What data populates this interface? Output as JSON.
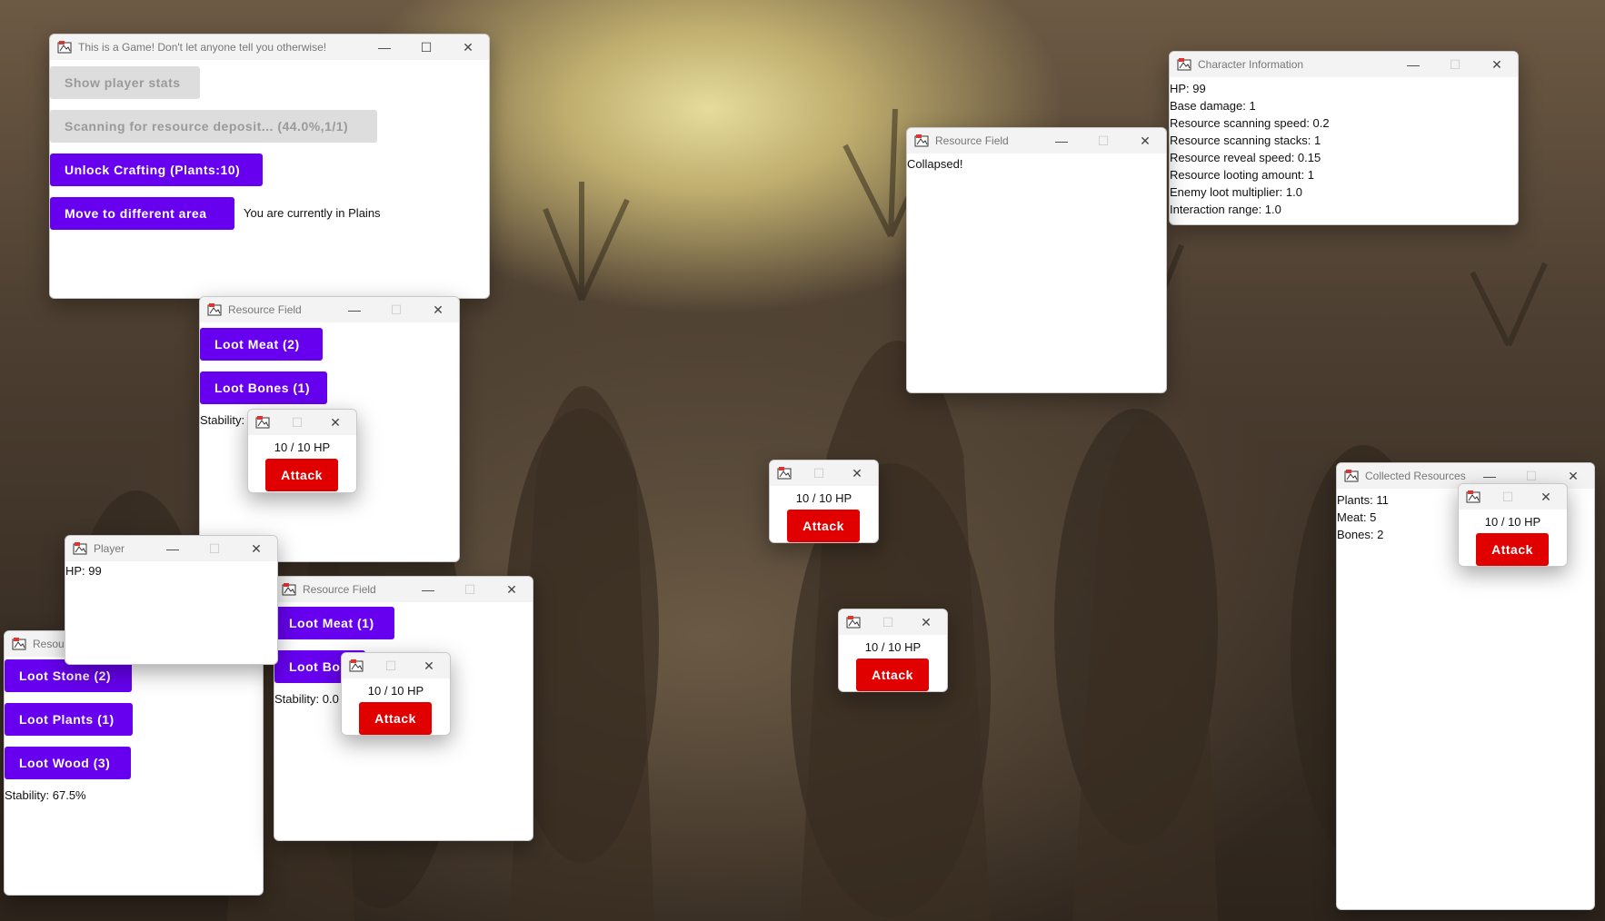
{
  "main_window": {
    "title": "This is a Game! Don't let anyone tell you otherwise!",
    "show_stats_label": "Show player stats",
    "scanning_label": "Scanning for resource deposit... (44.0%,1/1)",
    "unlock_crafting_label": "Unlock Crafting (Plants:10)",
    "move_area_label": "Move to different area",
    "location_text": "You are currently in Plains"
  },
  "character_info": {
    "title": "Character Information",
    "lines": [
      "HP: 99",
      "Base damage: 1",
      "Resource scanning speed: 0.2",
      "Resource scanning stacks: 1",
      "Resource reveal speed: 0.15",
      "Resource looting amount: 1",
      "Enemy loot multiplier: 1.0",
      "Interaction range: 1.0"
    ]
  },
  "resource_field_collapsed": {
    "title": "Resource Field",
    "status": "Collapsed!"
  },
  "resource_field_a": {
    "title": "Resource Field",
    "buttons": [
      "Loot Meat (2)",
      "Loot Bones (1)"
    ],
    "stability": "Stability:"
  },
  "resource_field_b": {
    "title": "Resource Field",
    "buttons": [
      "Loot Meat (1)",
      "Loot Bo"
    ],
    "stability": "Stability: 0.0"
  },
  "resource_field_c": {
    "title": "Resour",
    "buttons": [
      "Loot Stone (2)",
      "Loot Plants (1)",
      "Loot Wood (3)"
    ],
    "stability": "Stability: 67.5%"
  },
  "player_window": {
    "title": "Player",
    "hp": "HP: 99"
  },
  "collected_resources": {
    "title": "Collected Resources",
    "lines": [
      "Plants: 11",
      "Meat: 5",
      "Bones: 2"
    ]
  },
  "enemies": [
    {
      "hp": "10 / 10 HP",
      "attack_label": "Attack"
    },
    {
      "hp": "10 / 10 HP",
      "attack_label": "Attack"
    },
    {
      "hp": "10 / 10 HP",
      "attack_label": "Attack"
    },
    {
      "hp": "10 / 10 HP",
      "attack_label": "Attack"
    },
    {
      "hp": "10 / 10 HP",
      "attack_label": "Attack"
    }
  ],
  "colors": {
    "button_purple": "#6600ee",
    "button_red": "#e00000",
    "button_disabled": "#dddddd"
  },
  "window_controls": {
    "minimize": "—",
    "maximize": "☐",
    "close": "✕"
  }
}
